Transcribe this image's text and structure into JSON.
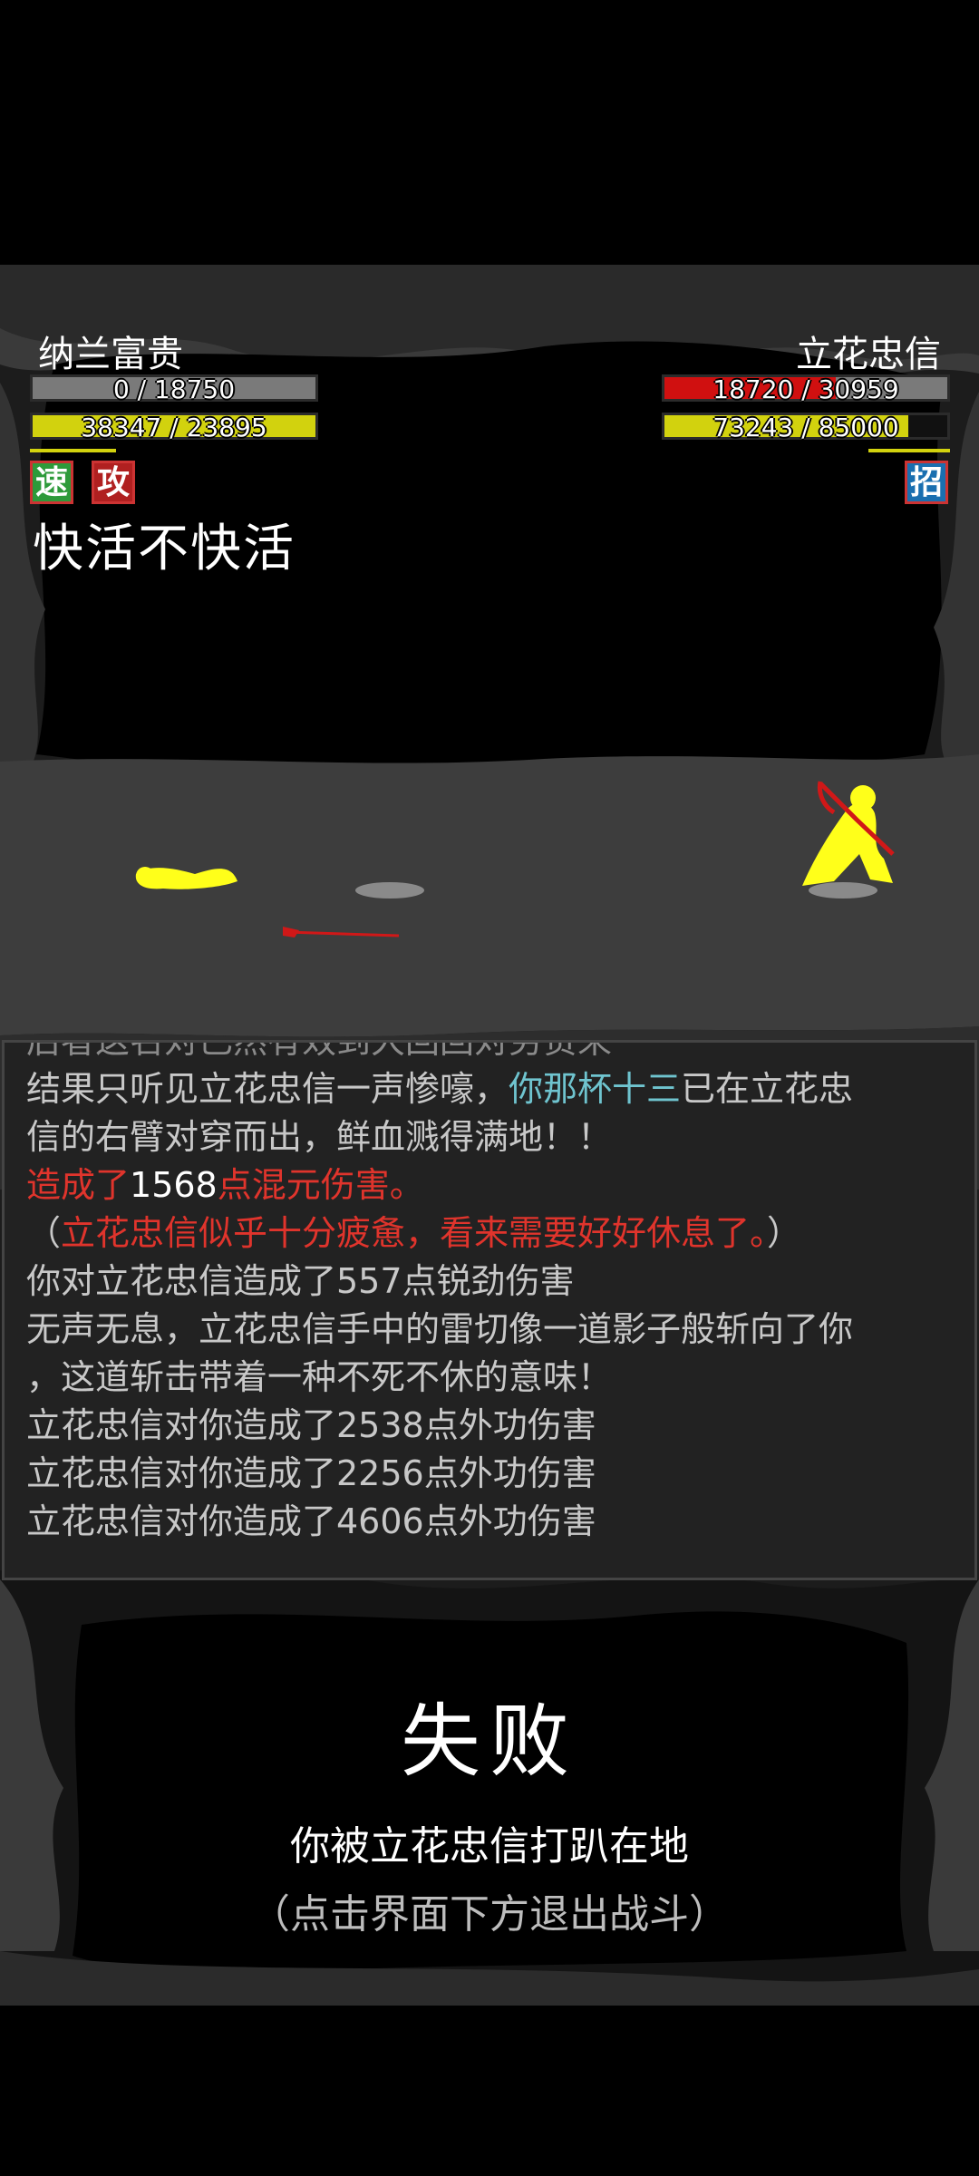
{
  "player": {
    "name": "纳兰富贵",
    "hp_text": "0 / 18750",
    "hp_fraction": 0,
    "mp_text": "38347 / 23895",
    "mp_fraction": 1,
    "statuses": [
      {
        "label": "速",
        "color": "#2d9a3a"
      },
      {
        "label": "攻",
        "color": "#b02020"
      }
    ]
  },
  "enemy": {
    "name": "立花忠信",
    "hp_text": "18720 / 30959",
    "hp_fraction": 0.6047,
    "mp_text": "73243 / 85000",
    "mp_fraction": 0.8617,
    "statuses": [
      {
        "label": "招",
        "color": "#1a6fb0"
      }
    ]
  },
  "skill_name": "快活不快活",
  "battle_log": {
    "line_partial": "后者这名对已然有效到大回回对劳贵来",
    "line1_a": "结果只听见立花忠信一声惨嚎，",
    "line1_b": "你那杯十三",
    "line1_c": "已在立花忠",
    "line2": "信的右臂对穿而出，鲜血溅得满地！！",
    "line3_a": "造成了",
    "line3_b": "1568",
    "line3_c": "点混元伤害。",
    "line4_a": "（",
    "line4_b": "立花忠信似乎十分疲惫，看来需要好好休息了。",
    "line4_c": "）",
    "line5": "你对立花忠信造成了557点锐劲伤害",
    "line6": "无声无息，立花忠信手中的雷切像一道影子般斩向了你",
    "line7": "，这道斩击带着一种不死不休的意味！",
    "line8": "立花忠信对你造成了2538点外功伤害",
    "line9": "立花忠信对你造成了2256点外功伤害",
    "line10": "立花忠信对你造成了4606点外功伤害"
  },
  "result": {
    "title": "失败",
    "message": "你被立花忠信打趴在地",
    "hint": "（点击界面下方退出战斗）"
  },
  "colors": {
    "hp_player": "#7a7a7a",
    "hp_enemy": "#d01010",
    "mp": "#d2d20e",
    "fighter": "#ffff1a",
    "blood": "#d01818"
  }
}
